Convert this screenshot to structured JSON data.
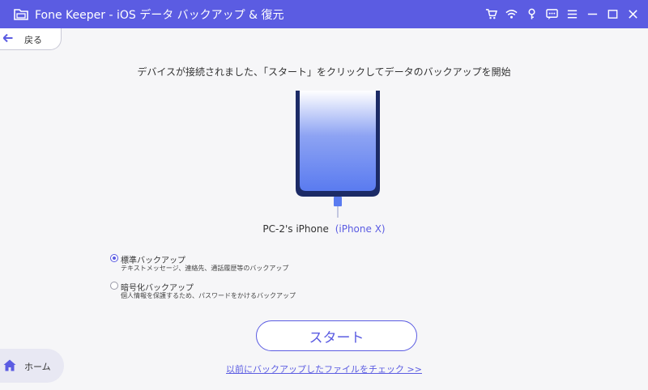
{
  "window": {
    "title": "Fone Keeper - iOS データ バックアップ & 復元",
    "toolbar_icons": [
      "cart-icon",
      "wifi-icon",
      "key-icon",
      "chat-icon",
      "menu-icon",
      "minimize-icon",
      "maximize-icon",
      "close-icon"
    ]
  },
  "nav": {
    "back_label": "戻る",
    "home_label": "ホーム"
  },
  "main": {
    "instruction": "デバイスが接続されました、「スタート」をクリックしてデータのバックアップを開始",
    "device": {
      "name": "PC-2's iPhone",
      "model": "(iPhone X)"
    },
    "options": [
      {
        "title": "標準バックアップ",
        "description": "テキストメッセージ、連絡先、通話履歴等のバックアップ",
        "selected": true
      },
      {
        "title": "暗号化バックアップ",
        "description": "個人情報を保護するため、パスワードをかけるバックアップ",
        "selected": false
      }
    ],
    "start_label": "スタート",
    "check_link": "以前にバックアップしたファイルをチェック >>"
  },
  "colors": {
    "accent": "#5b5ce2",
    "background": "#f6f6f8",
    "phone_body": "#1c2b66",
    "phone_screen_top": "#ffffff",
    "phone_screen_bottom": "#5a7bf0"
  }
}
